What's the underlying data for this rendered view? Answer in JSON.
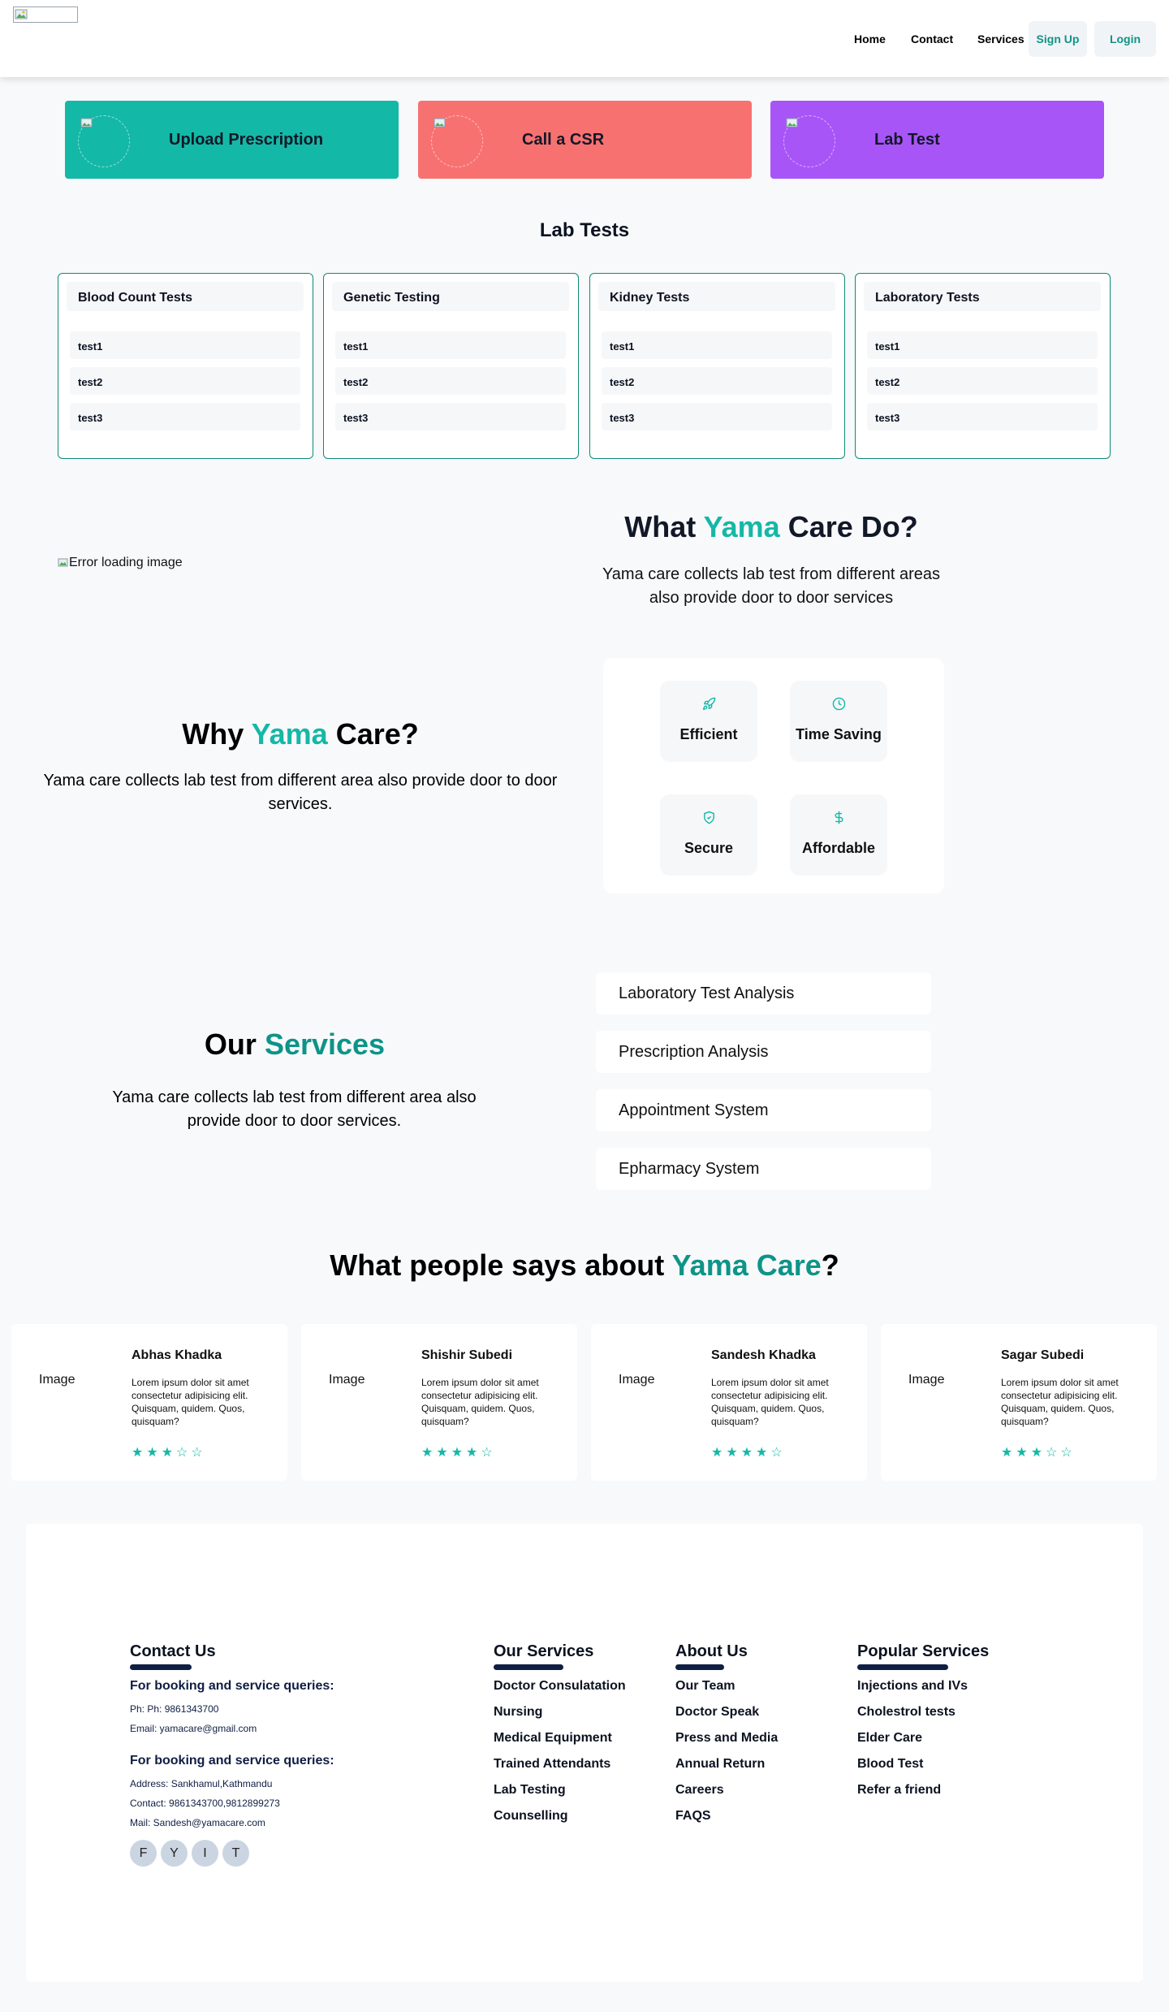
{
  "header": {
    "logo_alt": "",
    "nav": [
      "Home",
      "Contact",
      "Services"
    ],
    "signup_label": "Sign Up",
    "login_label": "Login"
  },
  "actions": [
    {
      "label": "Upload Prescription",
      "color": "#14b8a6"
    },
    {
      "label": "Call a CSR",
      "color": "#f87171"
    },
    {
      "label": "Lab Test",
      "color": "#a855f7"
    }
  ],
  "lab_tests": {
    "title": "Lab Tests",
    "categories": [
      {
        "name": "Blood Count Tests",
        "items": [
          "test1",
          "test2",
          "test3"
        ]
      },
      {
        "name": "Genetic Testing",
        "items": [
          "test1",
          "test2",
          "test3"
        ]
      },
      {
        "name": "Kidney Tests",
        "items": [
          "test1",
          "test2",
          "test3"
        ]
      },
      {
        "name": "Laboratory Tests",
        "items": [
          "test1",
          "test2",
          "test3"
        ]
      }
    ]
  },
  "what_we_do": {
    "image_alt": "Error loading image",
    "title_pre": "What ",
    "title_accent": "Yama",
    "title_post": " Care Do?",
    "description": "Yama care collects lab test from different areas also provide door to door services"
  },
  "why": {
    "title_pre": "Why ",
    "title_accent": "Yama",
    "title_post": " Care?",
    "description": "Yama care collects lab test from different area also provide door to door services.",
    "features": [
      {
        "label": "Efficient",
        "icon": "rocket-icon"
      },
      {
        "label": "Time Saving",
        "icon": "clock-icon"
      },
      {
        "label": "Secure",
        "icon": "shield-check-icon"
      },
      {
        "label": "Affordable",
        "icon": "dollar-icon"
      }
    ]
  },
  "services": {
    "title_pre": "Our ",
    "title_accent": "Services",
    "description": "Yama care collects lab test from different area also provide door to door services.",
    "items": [
      "Laboratory Test Analysis",
      "Prescription Analysis",
      "Appointment System",
      "Epharmacy System"
    ]
  },
  "testimonials": {
    "title_pre": "What people says about ",
    "title_accent": "Yama Care",
    "title_post": "?",
    "items": [
      {
        "image_alt": "Image",
        "name": "Abhas Khadka",
        "text": "Lorem ipsum dolor sit amet consectetur adipisicing elit. Quisquam, quidem. Quos, quisquam?",
        "stars": "★★★☆☆",
        "rating": 3
      },
      {
        "image_alt": "Image",
        "name": "Shishir Subedi",
        "text": "Lorem ipsum dolor sit amet consectetur adipisicing elit. Quisquam, quidem. Quos, quisquam?",
        "stars": "★★★★☆",
        "rating": 4
      },
      {
        "image_alt": "Image",
        "name": "Sandesh Khadka",
        "text": "Lorem ipsum dolor sit amet consectetur adipisicing elit. Quisquam, quidem. Quos, quisquam?",
        "stars": "★★★★☆",
        "rating": 4
      },
      {
        "image_alt": "Image",
        "name": "Sagar Subedi",
        "text": "Lorem ipsum dolor sit amet consectetur adipisicing elit. Quisquam, quidem. Quos, quisquam?",
        "stars": "★★★☆☆",
        "rating": 3
      }
    ]
  },
  "footer": {
    "contact": {
      "title": "Contact Us",
      "booking_heading_1": "For booking and service queries:",
      "phone": "Ph: Ph: 9861343700",
      "email": "Email: yamacare@gmail.com",
      "booking_heading_2": "For booking and service queries:",
      "address": "Address: Sankhamul,Kathmandu",
      "contact": "Contact: 9861343700,9812899273",
      "mail": "Mail: Sandesh@yamacare.com",
      "social": [
        "F",
        "Y",
        "I",
        "T"
      ]
    },
    "our_services": {
      "title": "Our Services",
      "links": [
        "Doctor Consulatation",
        "Nursing",
        "Medical Equipment",
        "Trained Attendants",
        "Lab Testing",
        "Counselling"
      ]
    },
    "about": {
      "title": "About Us",
      "links": [
        "Our Team",
        "Doctor Speak",
        "Press and Media",
        "Annual Return",
        "Careers",
        "FAQS"
      ]
    },
    "popular": {
      "title": "Popular Services",
      "links": [
        "Injections and IVs",
        "Cholestrol tests",
        "Elder Care",
        "Blood Test",
        "Refer a friend"
      ]
    }
  }
}
